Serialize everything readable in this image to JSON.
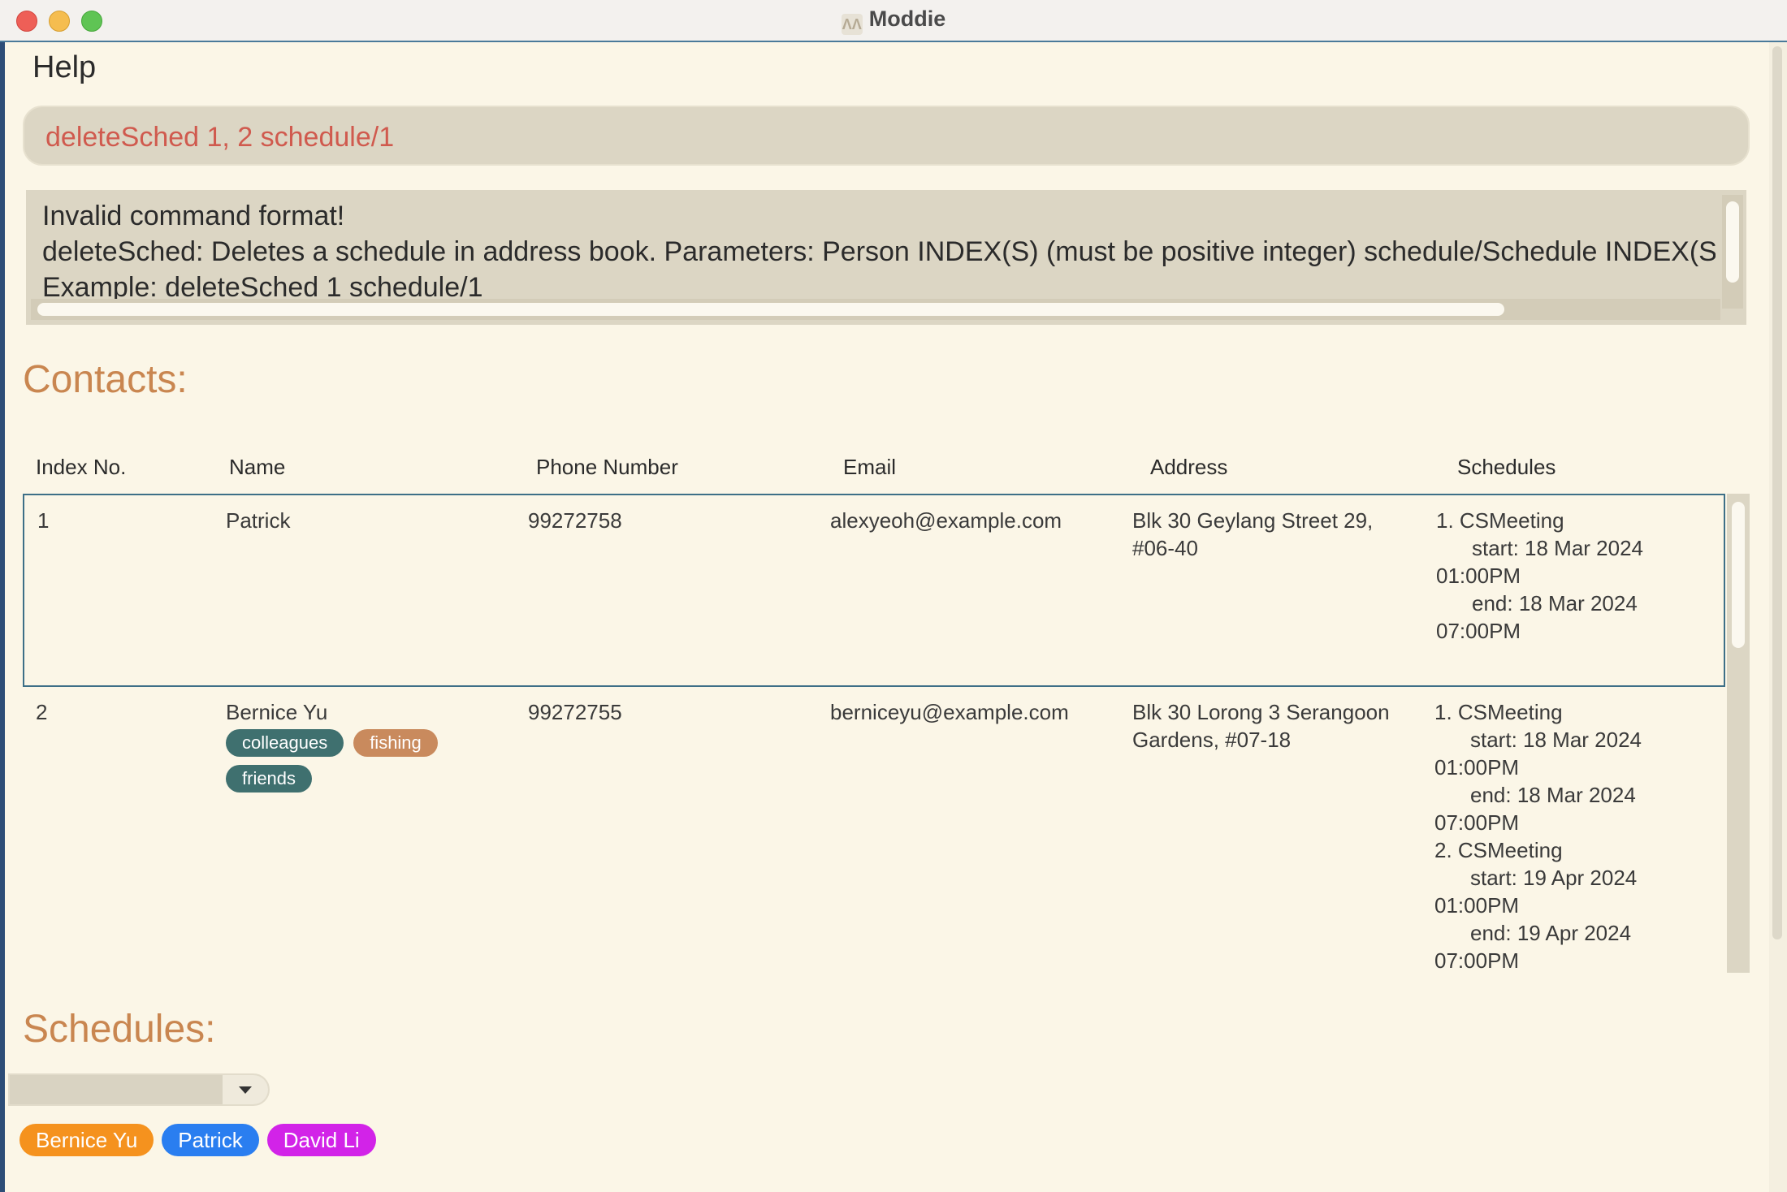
{
  "window": {
    "title": "Moddie"
  },
  "menu": {
    "help": "Help"
  },
  "command_box": {
    "value": "deleteSched 1, 2 schedule/1"
  },
  "result": {
    "lines": [
      "Invalid command format!",
      "deleteSched: Deletes a schedule in address book. Parameters: Person INDEX(S) (must be positive integer) schedule/Schedule INDEX(S) (must b",
      "Example: deleteSched 1 schedule/1"
    ]
  },
  "contacts": {
    "heading": "Contacts:",
    "columns": [
      "Index No.",
      "Name",
      "Phone Number",
      "Email",
      "Address",
      "Schedules"
    ],
    "rows": [
      {
        "index": "1",
        "name": "Patrick",
        "phone": "99272758",
        "email": "alexyeoh@example.com",
        "address": [
          "Blk 30 Geylang Street 29,",
          "#06-40"
        ],
        "tags": [],
        "schedules": [
          "1. CSMeeting",
          "start: 18 Mar 2024",
          "01:00PM",
          "end: 18 Mar 2024",
          "07:00PM"
        ]
      },
      {
        "index": "2",
        "name": "Bernice Yu",
        "phone": "99272755",
        "email": "berniceyu@example.com",
        "address": [
          "Blk 30 Lorong 3 Serangoon",
          "Gardens, #07-18"
        ],
        "tags": [
          {
            "label": "colleagues",
            "color": "#3f706f"
          },
          {
            "label": "fishing",
            "color": "#c98a5d"
          },
          {
            "label": "friends",
            "color": "#3f706f"
          }
        ],
        "schedules": [
          "1. CSMeeting",
          "start: 18 Mar 2024",
          "01:00PM",
          "end: 18 Mar 2024",
          "07:00PM",
          "2. CSMeeting",
          "start: 19 Apr 2024",
          "01:00PM",
          "end: 19 Apr 2024",
          "07:00PM"
        ]
      }
    ]
  },
  "schedules_section": {
    "heading": "Schedules:",
    "dropdown_value": "",
    "people": [
      {
        "name": "Bernice Yu",
        "color": "#f5921e"
      },
      {
        "name": "Patrick",
        "color": "#2a7ef0"
      },
      {
        "name": "David Li",
        "color": "#d223e8"
      }
    ]
  },
  "colors": {
    "background": "#fbf6e7",
    "accent_heading": "#c98650",
    "error_text": "#d05a4e",
    "selection_border": "#3d6f87"
  }
}
